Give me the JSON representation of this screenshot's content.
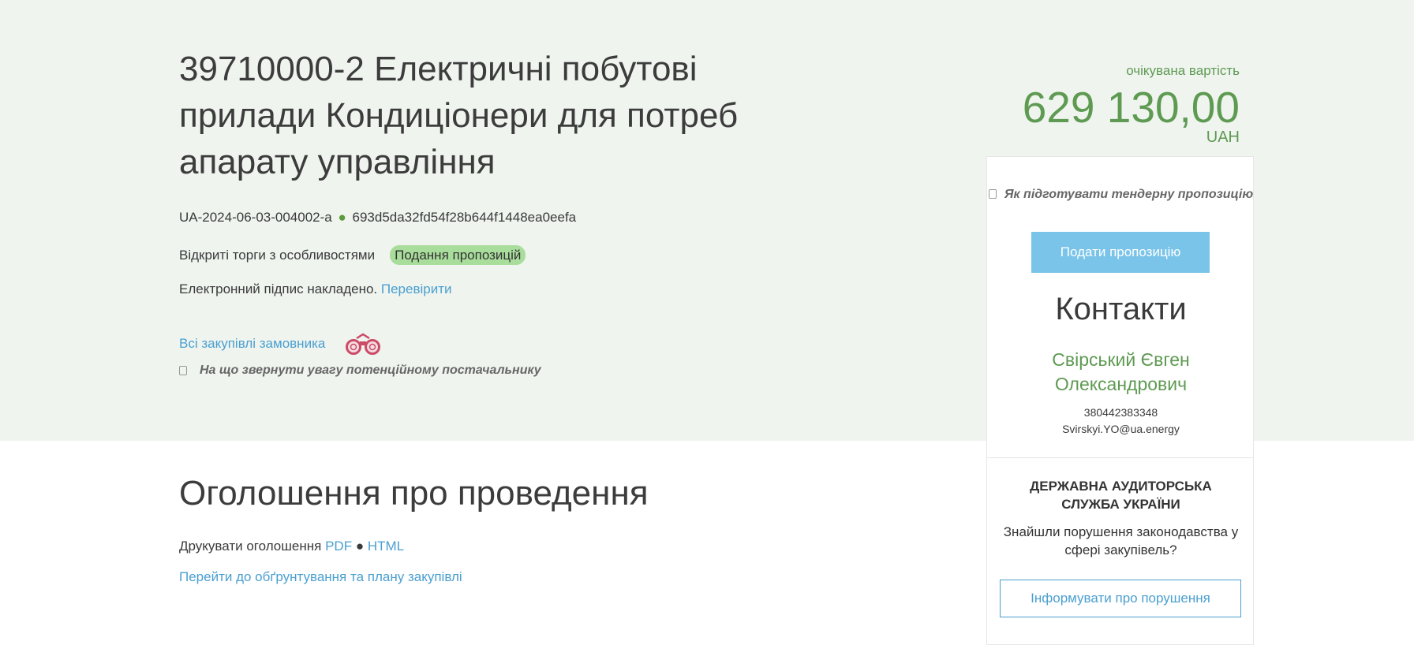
{
  "tender": {
    "title": "39710000-2 Електричні побутові прилади Кондиціонери для потреб апарату управління",
    "tender_id": "UA-2024-06-03-004002-a",
    "separator": "●",
    "hash": "693d5da32fd54f28b644f1448ea0eefa",
    "procedure_type": "Відкриті торги з особливостями",
    "status_badge": "Подання пропозицій",
    "signature_text": "Електронний підпис накладено.",
    "verify_link": "Перевірити",
    "all_purchases_link": "Всі закупівлі замовника",
    "attention_link": "На що звернути увагу потенційному постачальнику"
  },
  "budget": {
    "label": "очікувана вартість",
    "amount": "629 130,00",
    "currency": "UAH"
  },
  "sidebar": {
    "howto_link": "Як підготувати тендерну пропозицію",
    "submit_button": "Подати пропозицію",
    "contacts_heading": "Контакти",
    "contact_name": "Свірський Євген Олександрович",
    "phone": "380442383348",
    "email": "Svirskyi.YO@ua.energy",
    "audit_title": "ДЕРЖАВНА АУДИТОРСЬКА СЛУЖБА УКРАЇНИ",
    "audit_text": "Знайшли порушення законодавства у сфері закупівель?",
    "report_button": "Інформувати про порушення"
  },
  "announcement": {
    "heading": "Оголошення про проведення",
    "print_label": "Друкувати оголошення",
    "pdf_link": "PDF",
    "separator": "●",
    "html_link": "HTML",
    "plan_link": "Перейти до обґрунтування та плану закупівлі"
  },
  "colors": {
    "hero_background": "#eff4ef",
    "accent_green": "#5e9a52",
    "link_blue": "#4a9fd0",
    "badge_green": "#a9dd9b",
    "submit_button": "#7ac4e9"
  },
  "icons": {
    "binoculars": "binoculars-icon",
    "info": "info-icon"
  }
}
